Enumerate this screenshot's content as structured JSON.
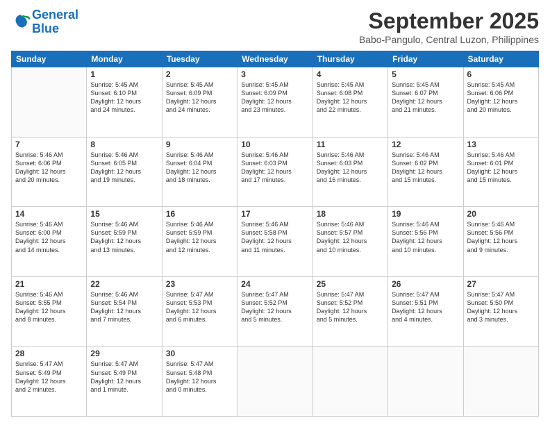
{
  "header": {
    "logo_line1": "General",
    "logo_line2": "Blue",
    "month": "September 2025",
    "location": "Babo-Pangulo, Central Luzon, Philippines"
  },
  "weekdays": [
    "Sunday",
    "Monday",
    "Tuesday",
    "Wednesday",
    "Thursday",
    "Friday",
    "Saturday"
  ],
  "weeks": [
    [
      {
        "day": "",
        "content": ""
      },
      {
        "day": "1",
        "content": "Sunrise: 5:45 AM\nSunset: 6:10 PM\nDaylight: 12 hours\nand 24 minutes."
      },
      {
        "day": "2",
        "content": "Sunrise: 5:45 AM\nSunset: 6:09 PM\nDaylight: 12 hours\nand 24 minutes."
      },
      {
        "day": "3",
        "content": "Sunrise: 5:45 AM\nSunset: 6:09 PM\nDaylight: 12 hours\nand 23 minutes."
      },
      {
        "day": "4",
        "content": "Sunrise: 5:45 AM\nSunset: 6:08 PM\nDaylight: 12 hours\nand 22 minutes."
      },
      {
        "day": "5",
        "content": "Sunrise: 5:45 AM\nSunset: 6:07 PM\nDaylight: 12 hours\nand 21 minutes."
      },
      {
        "day": "6",
        "content": "Sunrise: 5:45 AM\nSunset: 6:06 PM\nDaylight: 12 hours\nand 20 minutes."
      }
    ],
    [
      {
        "day": "7",
        "content": "Sunrise: 5:46 AM\nSunset: 6:06 PM\nDaylight: 12 hours\nand 20 minutes."
      },
      {
        "day": "8",
        "content": "Sunrise: 5:46 AM\nSunset: 6:05 PM\nDaylight: 12 hours\nand 19 minutes."
      },
      {
        "day": "9",
        "content": "Sunrise: 5:46 AM\nSunset: 6:04 PM\nDaylight: 12 hours\nand 18 minutes."
      },
      {
        "day": "10",
        "content": "Sunrise: 5:46 AM\nSunset: 6:03 PM\nDaylight: 12 hours\nand 17 minutes."
      },
      {
        "day": "11",
        "content": "Sunrise: 5:46 AM\nSunset: 6:03 PM\nDaylight: 12 hours\nand 16 minutes."
      },
      {
        "day": "12",
        "content": "Sunrise: 5:46 AM\nSunset: 6:02 PM\nDaylight: 12 hours\nand 15 minutes."
      },
      {
        "day": "13",
        "content": "Sunrise: 5:46 AM\nSunset: 6:01 PM\nDaylight: 12 hours\nand 15 minutes."
      }
    ],
    [
      {
        "day": "14",
        "content": "Sunrise: 5:46 AM\nSunset: 6:00 PM\nDaylight: 12 hours\nand 14 minutes."
      },
      {
        "day": "15",
        "content": "Sunrise: 5:46 AM\nSunset: 5:59 PM\nDaylight: 12 hours\nand 13 minutes."
      },
      {
        "day": "16",
        "content": "Sunrise: 5:46 AM\nSunset: 5:59 PM\nDaylight: 12 hours\nand 12 minutes."
      },
      {
        "day": "17",
        "content": "Sunrise: 5:46 AM\nSunset: 5:58 PM\nDaylight: 12 hours\nand 11 minutes."
      },
      {
        "day": "18",
        "content": "Sunrise: 5:46 AM\nSunset: 5:57 PM\nDaylight: 12 hours\nand 10 minutes."
      },
      {
        "day": "19",
        "content": "Sunrise: 5:46 AM\nSunset: 5:56 PM\nDaylight: 12 hours\nand 10 minutes."
      },
      {
        "day": "20",
        "content": "Sunrise: 5:46 AM\nSunset: 5:56 PM\nDaylight: 12 hours\nand 9 minutes."
      }
    ],
    [
      {
        "day": "21",
        "content": "Sunrise: 5:46 AM\nSunset: 5:55 PM\nDaylight: 12 hours\nand 8 minutes."
      },
      {
        "day": "22",
        "content": "Sunrise: 5:46 AM\nSunset: 5:54 PM\nDaylight: 12 hours\nand 7 minutes."
      },
      {
        "day": "23",
        "content": "Sunrise: 5:47 AM\nSunset: 5:53 PM\nDaylight: 12 hours\nand 6 minutes."
      },
      {
        "day": "24",
        "content": "Sunrise: 5:47 AM\nSunset: 5:52 PM\nDaylight: 12 hours\nand 5 minutes."
      },
      {
        "day": "25",
        "content": "Sunrise: 5:47 AM\nSunset: 5:52 PM\nDaylight: 12 hours\nand 5 minutes."
      },
      {
        "day": "26",
        "content": "Sunrise: 5:47 AM\nSunset: 5:51 PM\nDaylight: 12 hours\nand 4 minutes."
      },
      {
        "day": "27",
        "content": "Sunrise: 5:47 AM\nSunset: 5:50 PM\nDaylight: 12 hours\nand 3 minutes."
      }
    ],
    [
      {
        "day": "28",
        "content": "Sunrise: 5:47 AM\nSunset: 5:49 PM\nDaylight: 12 hours\nand 2 minutes."
      },
      {
        "day": "29",
        "content": "Sunrise: 5:47 AM\nSunset: 5:49 PM\nDaylight: 12 hours\nand 1 minute."
      },
      {
        "day": "30",
        "content": "Sunrise: 5:47 AM\nSunset: 5:48 PM\nDaylight: 12 hours\nand 0 minutes."
      },
      {
        "day": "",
        "content": ""
      },
      {
        "day": "",
        "content": ""
      },
      {
        "day": "",
        "content": ""
      },
      {
        "day": "",
        "content": ""
      }
    ]
  ]
}
